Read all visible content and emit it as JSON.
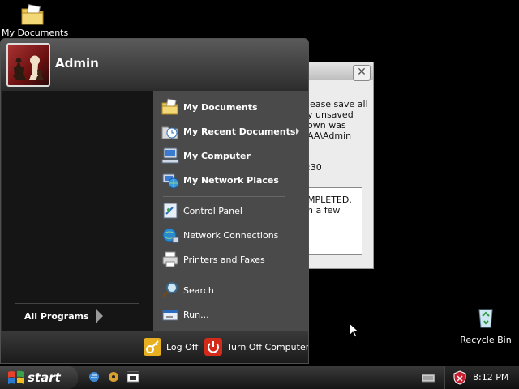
{
  "desktop": {
    "icons": [
      {
        "label": "My Documents",
        "icon": "folder-documents-icon"
      },
      {
        "label": "Recycle Bin",
        "icon": "recycle-bin-icon"
      }
    ]
  },
  "dialog": {
    "close_glyph": "✕",
    "message_lines": [
      "lease save all",
      "y unsaved",
      "own was",
      "AA\\Admin"
    ],
    "time_fragment": ":30",
    "status_lines": [
      "MPLETED.",
      "n a few"
    ]
  },
  "start_menu": {
    "username": "Admin",
    "all_programs": "All Programs",
    "places": [
      {
        "label": "My Documents",
        "icon": "my-documents-icon",
        "bold": true
      },
      {
        "label": "My Recent Documents",
        "icon": "recent-documents-icon",
        "bold": true,
        "submenu": true
      },
      {
        "label": "My Computer",
        "icon": "my-computer-icon",
        "bold": true
      },
      {
        "label": "My Network Places",
        "icon": "network-places-icon",
        "bold": true
      }
    ],
    "system": [
      {
        "label": "Control Panel",
        "icon": "control-panel-icon"
      },
      {
        "label": "Network Connections",
        "icon": "network-connections-icon"
      },
      {
        "label": "Printers and Faxes",
        "icon": "printer-icon"
      }
    ],
    "tools": [
      {
        "label": "Search",
        "icon": "search-icon"
      },
      {
        "label": "Run...",
        "icon": "run-icon"
      }
    ],
    "footer": {
      "log_off": "Log Off",
      "turn_off": "Turn Off Computer"
    }
  },
  "taskbar": {
    "start_label": "start",
    "quick_launch": [
      "ie-icon",
      "media-icon",
      "media-player-icon"
    ],
    "clock": "8:12 PM"
  },
  "colors": {
    "desktop_bg": "#000000",
    "menu_left_bg": "#151515",
    "menu_right_bg": "#4a4a4a",
    "log_off_accent": "#e8b020",
    "turn_off_accent": "#d42a1a"
  }
}
